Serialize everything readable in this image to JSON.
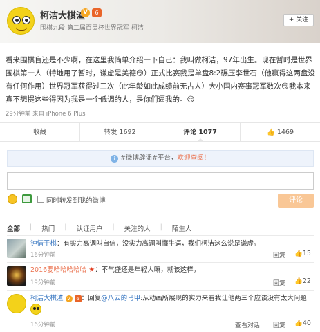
{
  "header": {
    "name": "柯洁大棋渣",
    "v_badge": "V",
    "level_badge": "6",
    "subtitle": "围棋九段 第二届百灵杯世界冠军 柯洁",
    "follow_label": "+ 关注"
  },
  "post": {
    "text": "看来围棋盲还是不少啊，在这里我简单介绍一下自己：我叫做柯洁，97年出生。现在暂时是世界围棋第一人（特地用了暂时，谦虚是美德😏）正式比赛我是单盘8:2碾压李世石（他赢得这两盘没有任何作用）世界冠军获得过三次（此年龄如此成绩前无古人）大小国内赛事冠军数次😏我本来真不想提这些得因为我是一个低调的人，是你们逼我的。😏",
    "meta": "29分钟前 来自 iPhone 6 Plus"
  },
  "actions": {
    "favorite": "收藏",
    "repost": "转发 1692",
    "comment": "评论 1077",
    "like_count": "1469"
  },
  "comment_box": {
    "notice_tag": "#微博辟谣#平台，",
    "notice_warn": "欢迎查阅！",
    "input_value": "",
    "repost_label": "同时转发到我的微博",
    "submit_label": "评论"
  },
  "filters": {
    "all": "全部",
    "hot": "热门",
    "verified": "认证用户",
    "following": "关注的人",
    "strangers": "陌生人"
  },
  "comments": [
    {
      "user": "钟情于棋",
      "text": "：有实力高调叫自信，没实力高调叫懂牛逼，我们柯洁这么说是谦虚。",
      "time": "16分钟前",
      "reply": "回复",
      "likes": "15"
    },
    {
      "user": "2016要哈哈哈哈哈",
      "badge": "★",
      "text": "：不气盛还是年轻人嘛，就该这样。",
      "time": "19分钟前",
      "reply": "回复",
      "likes": "22"
    },
    {
      "user": "柯洁大棋渣",
      "v_badge": "V",
      "level_badge": "6",
      "text_prefix": "：回复",
      "mention": "@八云的马甲",
      "text": ":从动画所展现的实力来看我让他两三个应该没有太大问题",
      "time": "16分钟前",
      "view_thread": "查看对话",
      "reply": "回复",
      "likes": "40"
    }
  ]
}
